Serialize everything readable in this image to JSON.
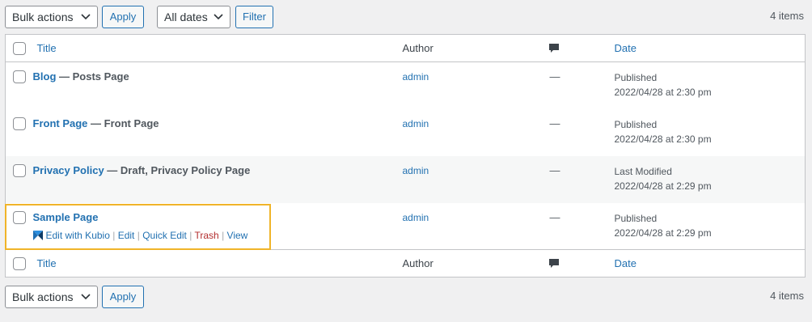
{
  "tablenav_top": {
    "bulk_actions": "Bulk actions",
    "apply": "Apply",
    "all_dates": "All dates",
    "filter": "Filter",
    "items_count": "4 items"
  },
  "table": {
    "columns": {
      "title": "Title",
      "author": "Author",
      "comments_icon": "comment-bubble-icon",
      "date": "Date"
    },
    "rows": [
      {
        "title": "Blog",
        "state": "— Posts Page",
        "author": "admin",
        "comments": "—",
        "status": "Published",
        "date": "2022/04/28 at 2:30 pm"
      },
      {
        "title": "Front Page",
        "state": "— Front Page",
        "author": "admin",
        "comments": "—",
        "status": "Published",
        "date": "2022/04/28 at 2:30 pm"
      },
      {
        "title": "Privacy Policy",
        "state": "— Draft, Privacy Policy Page",
        "author": "admin",
        "comments": "—",
        "status": "Last Modified",
        "date": "2022/04/28 at 2:29 pm"
      },
      {
        "title": "Sample Page",
        "state": "",
        "author": "admin",
        "comments": "—",
        "status": "Published",
        "date": "2022/04/28 at 2:29 pm",
        "actions": {
          "kubio": "Edit with Kubio",
          "edit": "Edit",
          "quick_edit": "Quick Edit",
          "trash": "Trash",
          "view": "View",
          "sep": "|"
        }
      }
    ]
  },
  "tablenav_bottom": {
    "bulk_actions": "Bulk actions",
    "apply": "Apply",
    "items_count": "4 items"
  },
  "colors": {
    "link": "#2271b1",
    "trash": "#b32d2e",
    "highlight": "#f0b429",
    "background": "#f0f0f1"
  }
}
